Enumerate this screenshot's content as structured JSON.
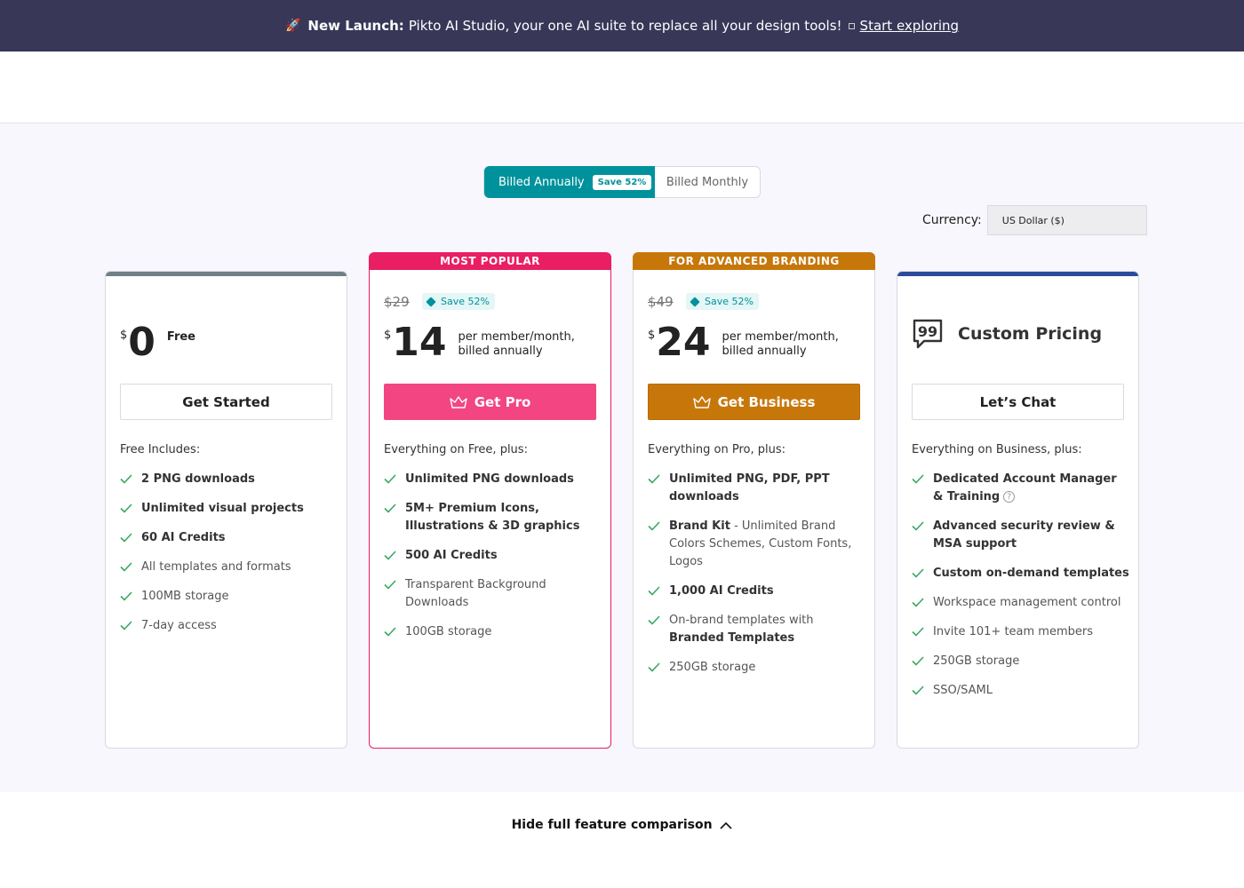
{
  "banner": {
    "prefix": "New Launch:",
    "text": "Pikto AI Studio, your one AI suite to replace all your design tools!",
    "link": "Start exploring"
  },
  "billing": {
    "annual_label": "Billed Annually",
    "annual_save": "Save 52%",
    "monthly_label": "Billed Monthly"
  },
  "currency": {
    "label": "Currency:",
    "value": "US Dollar ($)"
  },
  "plans": [
    {
      "name": "free",
      "accent": "#707f86",
      "currency_symbol": "$",
      "price": "0",
      "price_desc": "Free",
      "cta": "Get Started",
      "includes": "Free Includes:",
      "features": [
        "2 PNG downloads",
        "Unlimited visual projects",
        "60 AI Credits",
        "All templates and formats",
        "100MB storage",
        "7-day access"
      ]
    },
    {
      "name": "pro",
      "accent": "#e91e63",
      "ribbon": "MOST POPULAR",
      "old_price": "$29",
      "save": "Save 52%",
      "currency_symbol": "$",
      "price": "14",
      "price_desc": "per member/month, billed annually",
      "cta": "Get Pro",
      "includes": "Everything on Free, plus:",
      "features": [
        "Unlimited PNG downloads",
        "5M+ Premium Icons, Illustrations & 3D graphics",
        "500 AI Credits",
        "Transparent Background Downloads",
        "100GB storage"
      ]
    },
    {
      "name": "business",
      "accent": "#c7770a",
      "ribbon": "FOR ADVANCED BRANDING",
      "old_price": "$49",
      "save": "Save 52%",
      "currency_symbol": "$",
      "price": "24",
      "price_desc": "per member/month, billed annually",
      "cta": "Get Business",
      "includes": "Everything on Pro, plus:",
      "features": [
        "Unlimited PNG, PDF, PPT downloads",
        "Brand Kit",
        " - Unlimited Brand Colors Schemes, Custom Fonts, Logos",
        "1,000 AI Credits",
        "On-brand templates with ",
        "Branded Templates",
        "250GB storage"
      ]
    },
    {
      "name": "enterprise",
      "accent": "#2b4a9b",
      "title": "Custom Pricing",
      "cta": "Let’s Chat",
      "includes": "Everything on Business, plus:",
      "features": [
        "Dedicated Account Manager & Training",
        "Advanced security review & MSA support",
        "Custom on-demand templates",
        "Workspace management control",
        "Invite 101+ team members",
        "250GB storage",
        "SSO/SAML"
      ],
      "help_mark": "?"
    }
  ],
  "footer": {
    "hide_compare": "Hide full feature comparison"
  },
  "colors": {
    "banner_bg": "#383758",
    "teal": "#00929c",
    "check": "#3aa864"
  }
}
